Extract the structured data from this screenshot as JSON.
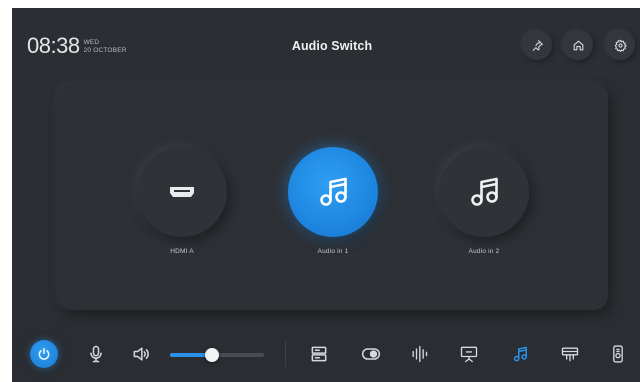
{
  "header": {
    "time": "08:38",
    "day": "WED",
    "date": "20 OCTOBER",
    "title": "Audio Switch",
    "buttons": [
      {
        "name": "pin-icon"
      },
      {
        "name": "home-icon"
      },
      {
        "name": "gear-icon"
      }
    ]
  },
  "sources": [
    {
      "label": "HDMI A",
      "icon": "hdmi-port-icon",
      "active": false
    },
    {
      "label": "Audio in 1",
      "icon": "music-note-icon",
      "active": true
    },
    {
      "label": "Audio in 2",
      "icon": "music-note-icon",
      "active": false
    }
  ],
  "toolbar": {
    "volume_level": 0.45,
    "items": [
      "power-icon",
      "microphone-icon",
      "speaker-icon",
      "switcher-icon",
      "toggle-icon",
      "audio-levels-icon",
      "presentation-icon",
      "music-note-icon",
      "projector-icon",
      "remote-icon"
    ],
    "active_item": "music-note-icon"
  },
  "colors": {
    "background": "#2b2e33",
    "accent": "#2b92ea",
    "text": "#eef0f2"
  }
}
